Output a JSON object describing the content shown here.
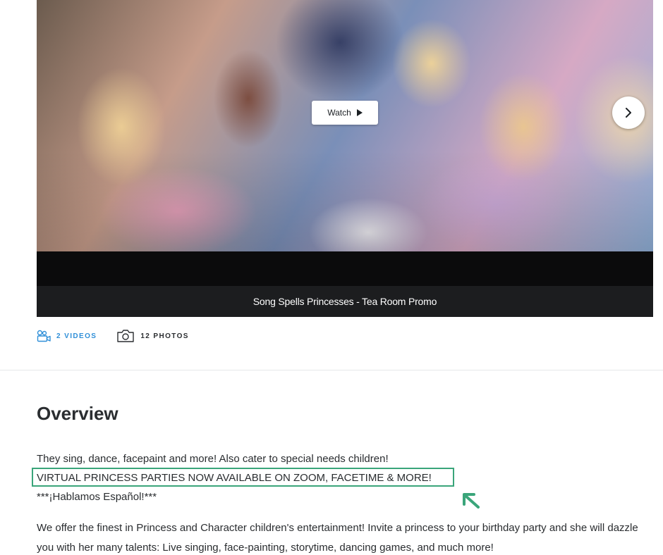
{
  "media": {
    "watch_label": "Watch",
    "caption": "Song Spells Princesses - Tea Room Promo",
    "next_icon": "chevron-right-icon",
    "play_icon": "play-icon"
  },
  "counts": {
    "videos_label": "2 VIDEOS",
    "photos_label": "12 PHOTOS",
    "videos_icon": "video-icon",
    "photos_icon": "camera-icon"
  },
  "overview": {
    "title": "Overview",
    "line1": "They sing, dance, facepaint and more! Also cater to special needs children!",
    "line2": "VIRTUAL PRINCESS PARTIES NOW AVAILABLE ON ZOOM, FACETIME & MORE!",
    "line3": "***¡Hablamos Español!***",
    "paragraph": "We offer the finest in Princess and Character children's entertainment! Invite a princess to your birthday party and she will dazzle you with her many talents: Live singing, face-painting, storytime, dancing games, and much more!"
  },
  "colors": {
    "accent_link": "#2f8fd8",
    "highlight": "#3aa57a",
    "caption_bg": "#1c1d1f"
  }
}
